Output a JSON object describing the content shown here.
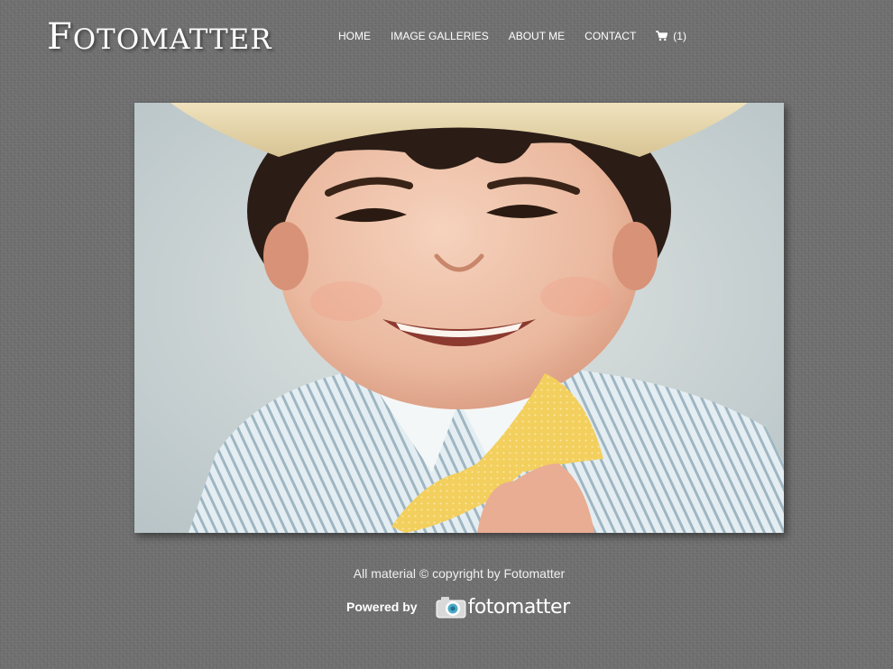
{
  "header": {
    "logo_text": "Fotomatter"
  },
  "nav": {
    "items": [
      {
        "label": "HOME"
      },
      {
        "label": "IMAGE GALLERIES"
      },
      {
        "label": "ABOUT ME"
      },
      {
        "label": "CONTACT"
      }
    ],
    "cart_count": "(1)",
    "cart_icon": "shopping-cart-icon"
  },
  "main": {
    "photo_subject": "smiling boy in straw hat and yellow bow tie"
  },
  "footer": {
    "copyright": "All material © copyright by Fotomatter",
    "powered_by_label": "Powered by",
    "powered_logo_text": "fotomatter",
    "powered_logo_icon": "camera-icon"
  },
  "colors": {
    "background": "#6f6f6f",
    "text": "#ffffff"
  }
}
